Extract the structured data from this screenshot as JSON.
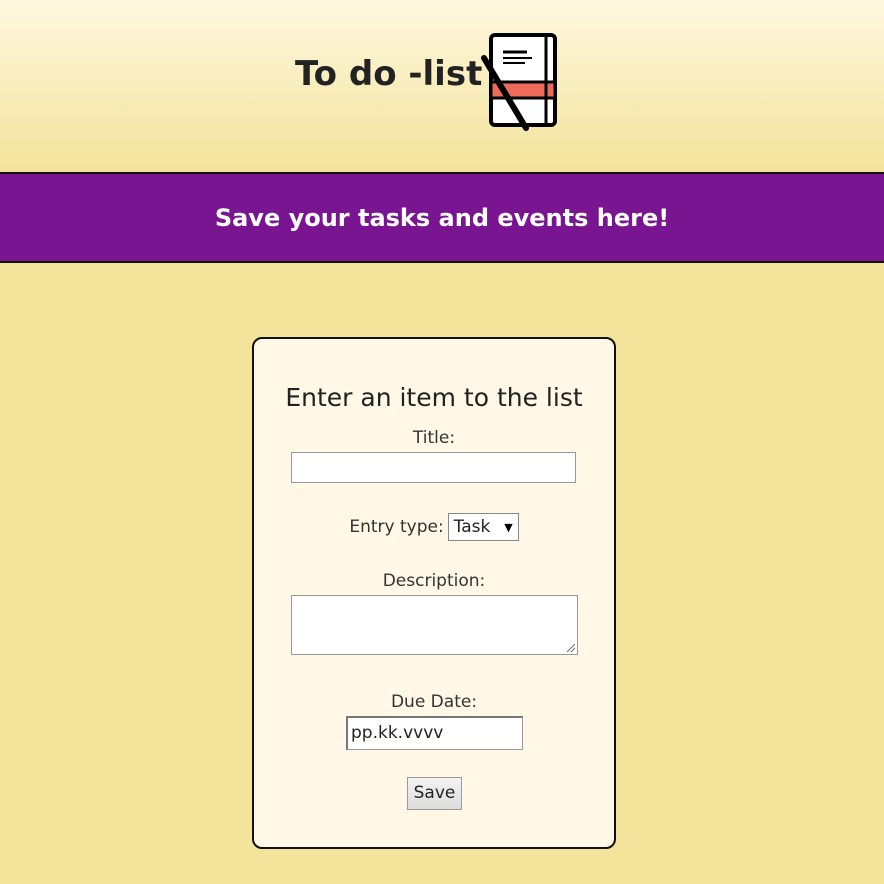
{
  "header": {
    "title": "To do -list",
    "icon": "notebook-pen-icon"
  },
  "banner": {
    "text": "Save your tasks and events here!"
  },
  "form": {
    "heading": "Enter an item to the list",
    "title_label": "Title:",
    "title_value": "",
    "entry_type_label": "Entry type:",
    "entry_type_selected": "Task",
    "description_label": "Description:",
    "description_value": "",
    "due_date_label": "Due Date:",
    "due_date_value": "pp.kk.vvvv",
    "save_label": "Save"
  },
  "colors": {
    "page_background": "#f3e39b",
    "banner_background": "#7a1591",
    "card_background": "#fff8e6",
    "icon_accent": "#ee6a5b"
  }
}
